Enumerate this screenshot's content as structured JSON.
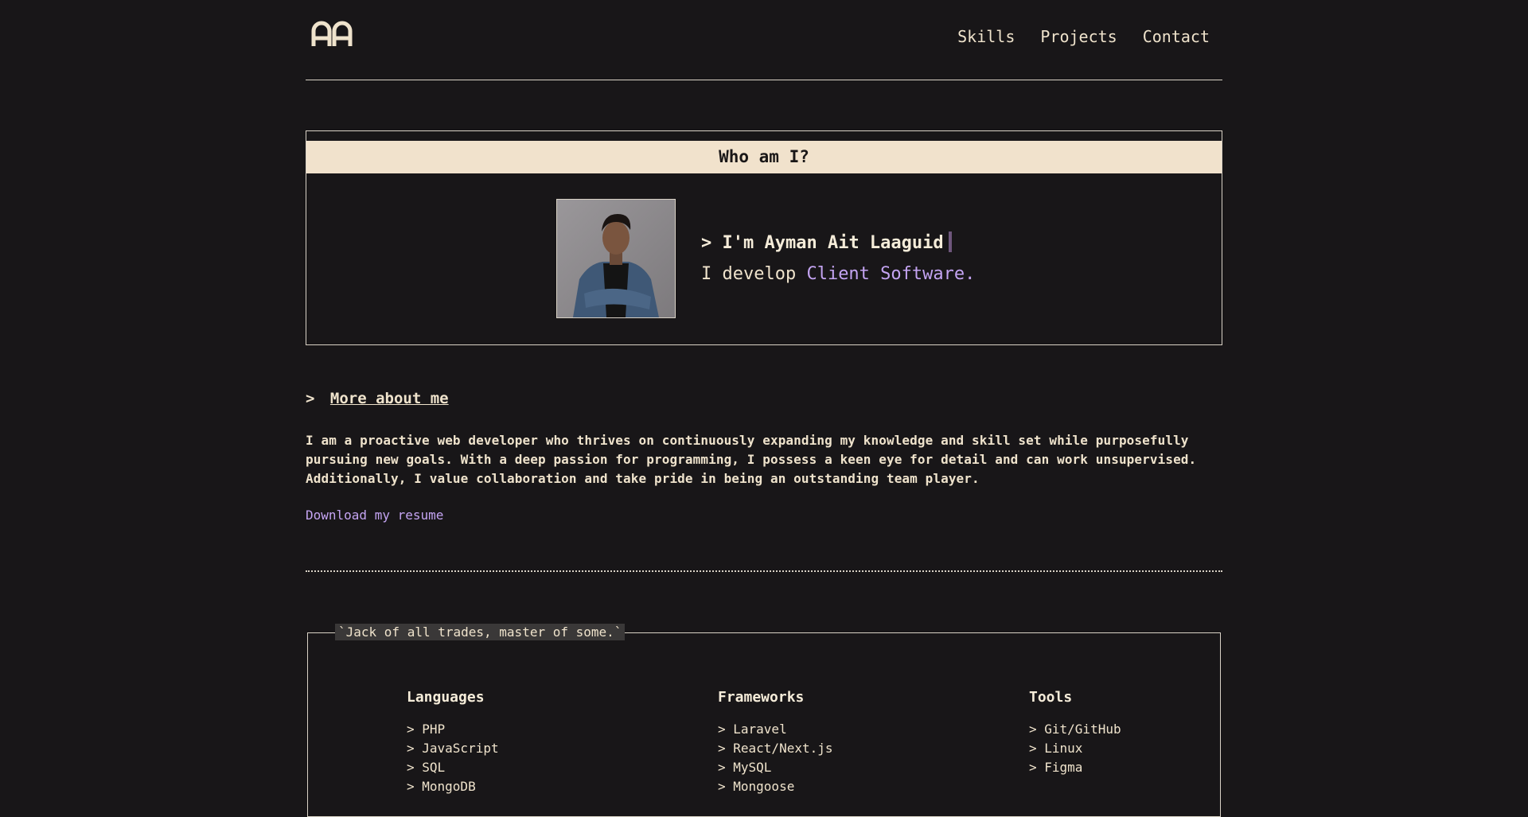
{
  "header": {
    "logo_text": "AA",
    "nav": [
      "Skills",
      "Projects",
      "Contact"
    ]
  },
  "who": {
    "title": "Who am I?",
    "name_prefix": "> ",
    "name": "I'm Ayman Ait Laaguid",
    "develop_prefix": "I develop ",
    "develop_highlight": "Client Software."
  },
  "more": {
    "prefix": ">",
    "link": "More about me",
    "bio": "I am a proactive web developer who thrives on continuously expanding my knowledge and skill set while purposefully pursuing new goals. With a deep passion for programming, I possess a keen eye for detail and can work unsupervised. Additionally, I value collaboration and take pride in being an outstanding team player.",
    "resume": "Download my resume"
  },
  "skills": {
    "legend": "`Jack of all trades, master of some.`",
    "columns": [
      {
        "title": "Languages",
        "items": [
          "> PHP",
          "> JavaScript",
          "> SQL",
          "> MongoDB"
        ]
      },
      {
        "title": "Frameworks",
        "items": [
          "> Laravel",
          "> React/Next.js",
          "> MySQL",
          "> Mongoose"
        ]
      },
      {
        "title": "Tools",
        "items": [
          "> Git/GitHub",
          "> Linux",
          "> Figma"
        ]
      }
    ]
  },
  "colors": {
    "background": "#181618",
    "text": "#efe3cc",
    "accent": "#c4a4f2",
    "title_bar": "#f1e2cc",
    "cursor": "#6e567c"
  }
}
